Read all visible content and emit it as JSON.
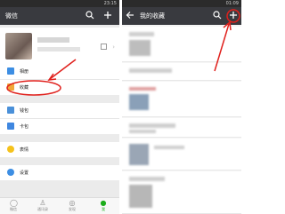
{
  "left_screen": {
    "status_time": "23:15",
    "title": "微信",
    "search_icon": "search-icon",
    "add_icon": "plus-icon",
    "menu": [
      {
        "label": "相册",
        "icon": "photo-icon",
        "color": "#3d8ee3"
      },
      {
        "label": "收藏",
        "icon": "favorites-cube-icon",
        "color": "#f0a73a"
      },
      {
        "label": "钱包",
        "icon": "wallet-icon",
        "color": "#4a90d9"
      },
      {
        "label": "卡包",
        "icon": "card-icon",
        "color": "#3f87e0"
      },
      {
        "label": "表情",
        "icon": "emoji-icon",
        "color": "#f5c21b"
      },
      {
        "label": "设置",
        "icon": "settings-gear-icon",
        "color": "#3d8ee3"
      }
    ],
    "bottom_nav": [
      {
        "label": "微信",
        "icon": "chat-icon",
        "active": false
      },
      {
        "label": "通讯录",
        "icon": "contacts-icon",
        "active": false
      },
      {
        "label": "发现",
        "icon": "discover-compass-icon",
        "active": false
      },
      {
        "label": "我",
        "icon": "me-icon",
        "active": true
      }
    ]
  },
  "right_screen": {
    "status_time": "01:09",
    "title": "我的收藏",
    "back_icon": "back-arrow-icon",
    "search_icon": "search-icon",
    "add_icon": "plus-icon"
  },
  "annotations": {
    "color": "#e0201c"
  }
}
